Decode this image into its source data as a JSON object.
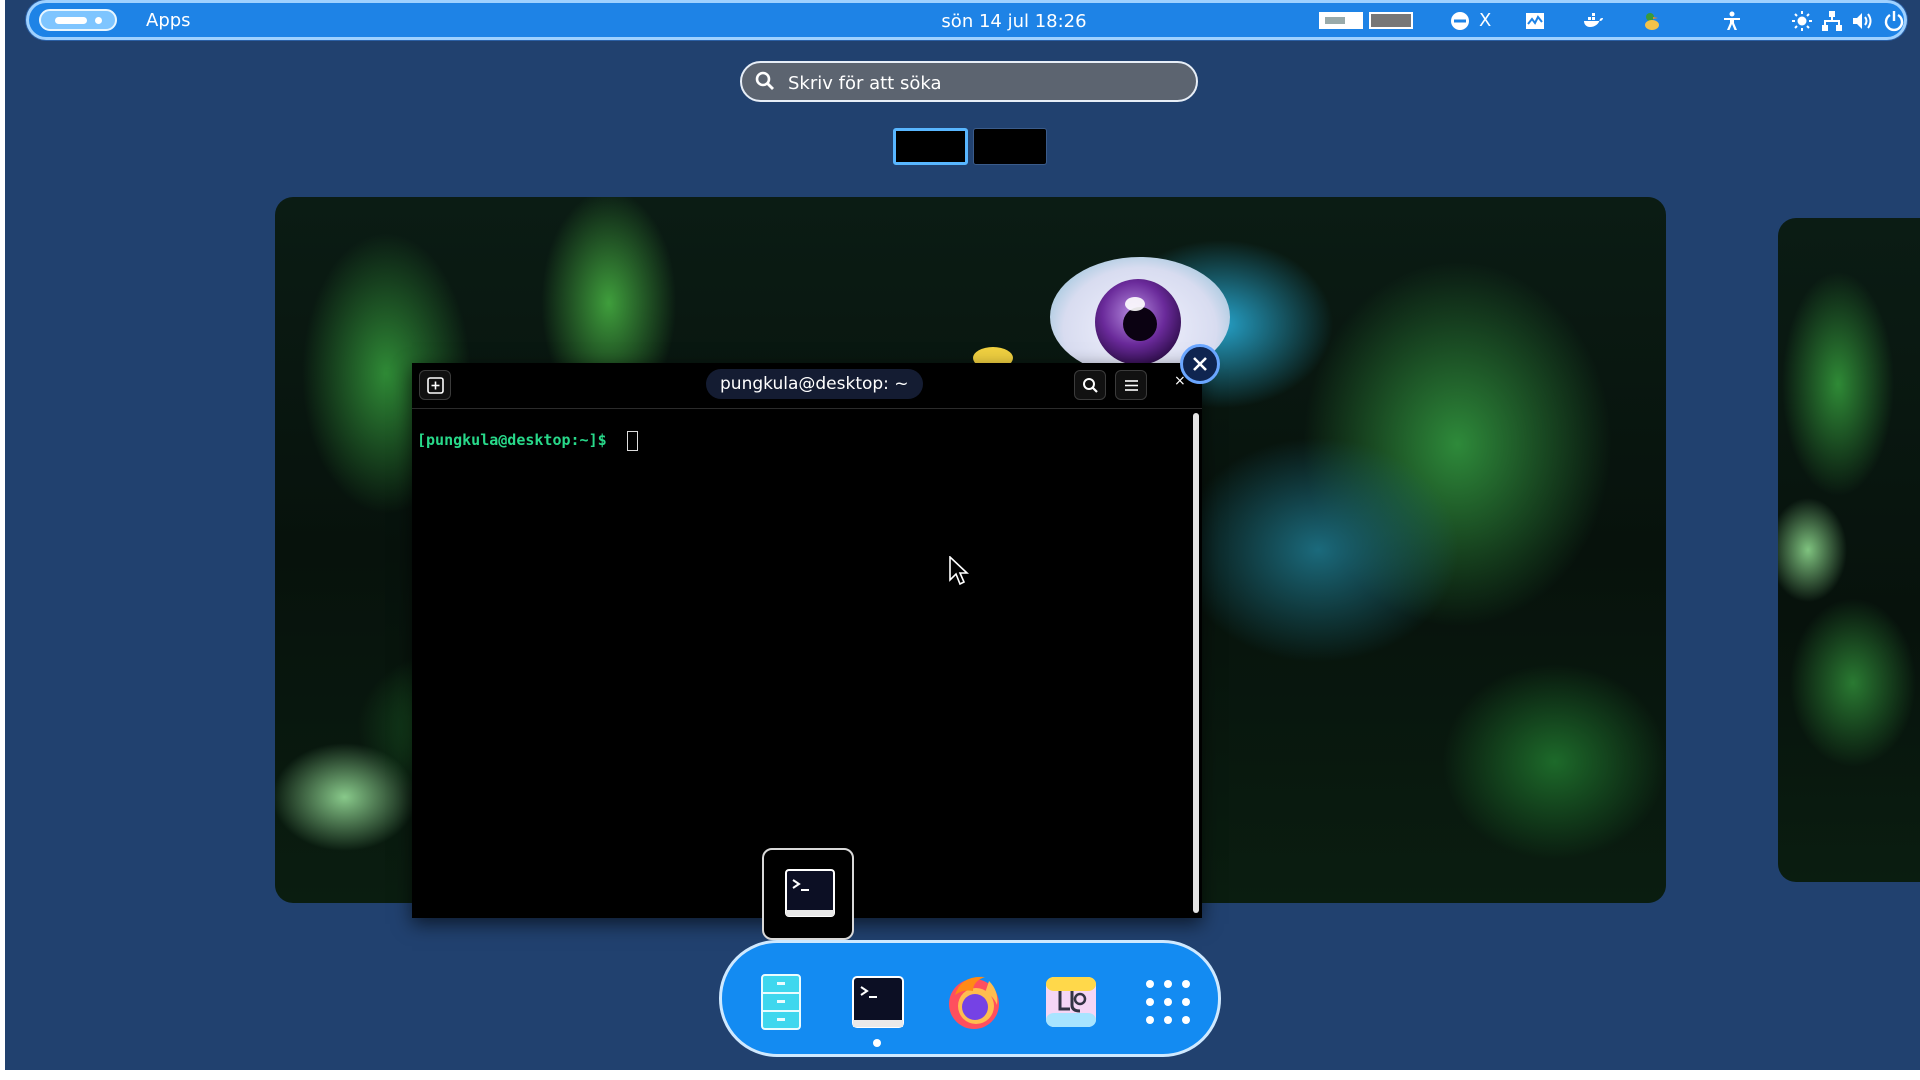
{
  "top_panel": {
    "apps_label": "Apps",
    "clock": "sön 14 jul  18:26",
    "tray_letter": "X"
  },
  "search": {
    "placeholder": "Skriv för att söka"
  },
  "terminal": {
    "title": "pungkula@desktop: ~",
    "prompt": "[pungkula@desktop:~]$",
    "close_glyph": "×"
  },
  "colors": {
    "background": "#21416f",
    "panel": "#1e83e6",
    "dock": "#138bf2",
    "prompt": "#28d98a"
  },
  "icons": {
    "tray": [
      "keyboard-layout-icon",
      "do-not-disturb-icon",
      "system-monitor-icon",
      "docker-icon",
      "duck-icon",
      "accessibility-icon",
      "brightness-icon",
      "network-icon",
      "volume-icon",
      "power-icon"
    ],
    "dock": [
      "files-icon",
      "terminal-icon",
      "firefox-icon",
      "text-editor-icon",
      "show-apps-icon"
    ]
  }
}
